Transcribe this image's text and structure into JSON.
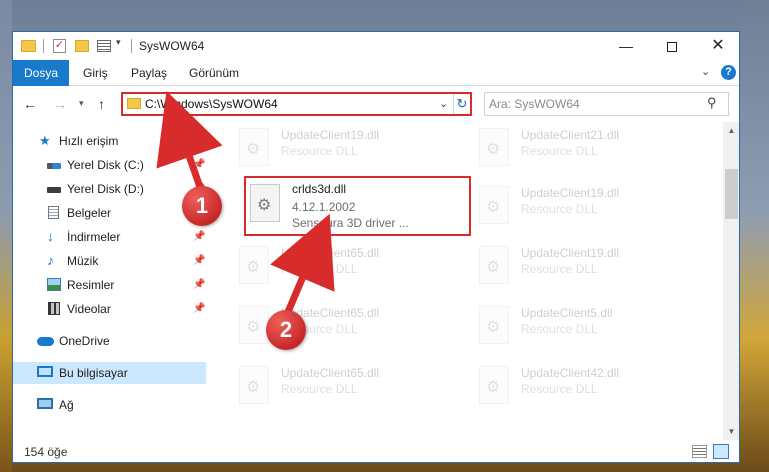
{
  "window": {
    "title": "SysWOW64",
    "min_glyph": "—",
    "close_glyph": "✕"
  },
  "ribbon": {
    "tabs": [
      "Dosya",
      "Giriş",
      "Paylaş",
      "Görünüm"
    ],
    "expand_glyph": "⌄",
    "help_glyph": "?"
  },
  "nav": {
    "back_glyph": "←",
    "forward_glyph": "→",
    "recent_glyph": "▾",
    "up_glyph": "↑"
  },
  "address": {
    "path": "C:\\Windows\\SysWOW64",
    "dropdown_glyph": "⌄",
    "refresh_glyph": "↻"
  },
  "search": {
    "placeholder": "Ara: SysWOW64",
    "icon_glyph": "⚲"
  },
  "sidebar": {
    "items": [
      {
        "label": "Hızlı erişim",
        "icon": "star-icon"
      },
      {
        "label": "Yerel Disk (C:)",
        "icon": "drive-icon",
        "pinned": true
      },
      {
        "label": "Yerel Disk (D:)",
        "icon": "drive-icon",
        "pinned": true
      },
      {
        "label": "Belgeler",
        "icon": "documents-icon",
        "pinned": true
      },
      {
        "label": "İndirmeler",
        "icon": "downloads-icon",
        "pinned": true
      },
      {
        "label": "Müzik",
        "icon": "music-icon",
        "pinned": true
      },
      {
        "label": "Resimler",
        "icon": "pictures-icon",
        "pinned": true
      },
      {
        "label": "Videolar",
        "icon": "videos-icon",
        "pinned": true
      },
      {
        "label": "OneDrive",
        "icon": "onedrive-icon"
      },
      {
        "label": "Bu bilgisayar",
        "icon": "computer-icon",
        "selected": true
      },
      {
        "label": "Ağ",
        "icon": "network-icon"
      }
    ],
    "pin_glyph": "📌"
  },
  "files": {
    "highlighted": {
      "name": "crlds3d.dll",
      "version": "4.12.1.2002",
      "description": "Sensaura 3D driver ..."
    },
    "left_column": [
      {
        "name": "UpdateClient19.dll",
        "type": "Resource DLL"
      },
      {
        "name": "UpdateClient65.dll",
        "type": "Resource DLL"
      },
      {
        "name": "UpdateClient65.dll",
        "type": "Resource DLL"
      },
      {
        "name": "UpdateClient65.dll",
        "type": "Resource DLL"
      }
    ],
    "right_column": [
      {
        "name": "UpdateClient21.dll",
        "type": "Resource DLL"
      },
      {
        "name": "UpdateClient19.dll",
        "type": "Resource DLL"
      },
      {
        "name": "UpdateClient19.dll",
        "type": "Resource DLL"
      },
      {
        "name": "UpdateClient5.dll",
        "type": "Resource DLL"
      },
      {
        "name": "UpdateClient42.dll",
        "type": "Resource DLL"
      }
    ]
  },
  "scrollbar": {
    "up_glyph": "▲",
    "down_glyph": "▼"
  },
  "status": {
    "item_count": "154 öğe"
  },
  "annotations": {
    "step1": "1",
    "step2": "2",
    "color": "#d82c2c"
  }
}
